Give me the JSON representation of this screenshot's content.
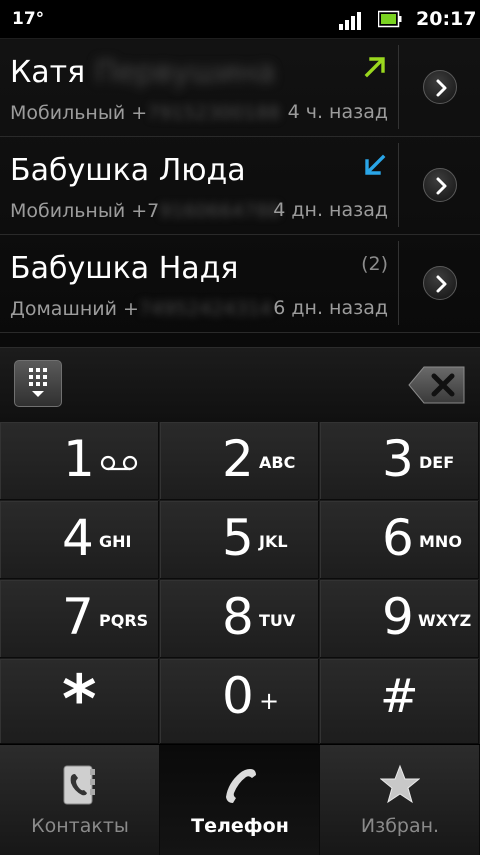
{
  "status_bar": {
    "temperature": "17°",
    "time": "20:17"
  },
  "call_log": [
    {
      "name": "Катя",
      "name_hidden": "Первушина",
      "phone_type": "Мобильный +",
      "phone_hidden": "79152300188",
      "when": "4 ч. назад",
      "call_type": "outgoing",
      "arrow_color": "#9ad81e",
      "count": ""
    },
    {
      "name": "Бабушка Люда",
      "name_hidden": "",
      "phone_type": "Мобильный +7",
      "phone_hidden": "9160664788",
      "when": "4 дн. назад",
      "call_type": "incoming",
      "arrow_color": "#2aa6e8",
      "count": ""
    },
    {
      "name": "Бабушка Надя",
      "name_hidden": "",
      "phone_type": "Домашний +",
      "phone_hidden": "74952424314",
      "when": "6 дн. назад",
      "call_type": "other",
      "arrow_color": "",
      "count": "(2)"
    }
  ],
  "keypad": {
    "keys": [
      {
        "digit": "1",
        "letters": "",
        "extra_icon": "voicemail-icon"
      },
      {
        "digit": "2",
        "letters": "ABC"
      },
      {
        "digit": "3",
        "letters": "DEF"
      },
      {
        "digit": "4",
        "letters": "GHI"
      },
      {
        "digit": "5",
        "letters": "JKL"
      },
      {
        "digit": "6",
        "letters": "MNO"
      },
      {
        "digit": "7",
        "letters": "PQRS"
      },
      {
        "digit": "8",
        "letters": "TUV"
      },
      {
        "digit": "9",
        "letters": "WXYZ"
      },
      {
        "digit": "*",
        "letters": ""
      },
      {
        "digit": "0",
        "letters": "+"
      },
      {
        "digit": "#",
        "letters": ""
      }
    ]
  },
  "tabs": [
    {
      "label": "Контакты",
      "icon": "contacts-book-icon",
      "active": false
    },
    {
      "label": "Телефон",
      "icon": "phone-handset-icon",
      "active": true
    },
    {
      "label": "Избран.",
      "icon": "star-icon",
      "active": false
    }
  ],
  "colors": {
    "outgoing_arrow": "#9ad81e",
    "incoming_arrow": "#2aa6e8",
    "background": "#0c0c0c"
  }
}
